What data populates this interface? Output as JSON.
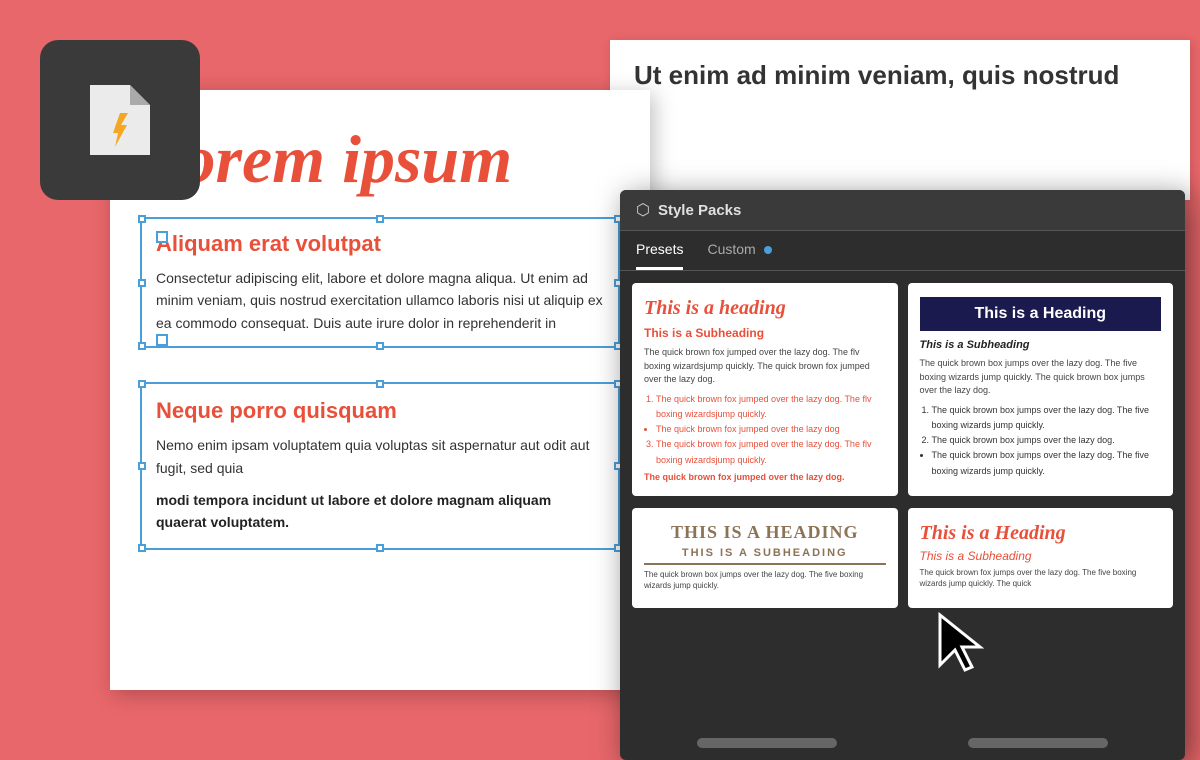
{
  "app": {
    "title": "Style Packs"
  },
  "background_doc": {
    "text": "Ut enim ad minim veniam, quis nostrud"
  },
  "document": {
    "title": "Lorem ipsum",
    "section1": {
      "heading": "Aliquam erat volutpat",
      "body": "Consectetur adipiscing elit, labore et dolore magna aliqua. Ut enim ad minim veniam, quis nostrud exercitation ullamco laboris nisi ut aliquip ex ea commodo consequat. Duis aute irure dolor in reprehenderit in"
    },
    "section2": {
      "heading": "Neque porro quisquam",
      "body": "Nemo enim ipsam voluptatem quia voluptas sit aspernatur aut odit aut fugit, sed quia",
      "bold": "modi tempora incidunt ut labore et dolore magnam aliquam quaerat voluptatem."
    }
  },
  "style_packs_panel": {
    "header": "Style Packs",
    "tabs": [
      {
        "label": "Presets",
        "active": true
      },
      {
        "label": "Custom",
        "active": false,
        "has_dot": true
      }
    ],
    "cards": [
      {
        "id": "card1",
        "heading": "This is a heading",
        "subheading": "This is a Subheading",
        "body": "The quick brown fox jumped over the lazy dog. The flv boxing wizardsjump quickly. The quick brown fox jumped over the lazy dog.",
        "list": [
          "The quick brown fox jumped over the lazy dog. The flv boxing wizardsjump quickly.",
          "The quick brown fox jumped over the lazy dog",
          "The quick brown fox jumped over the lazy dog. The flv boxing wizardsjump quickly."
        ],
        "bold": "The quick brown fox jumped over the lazy dog."
      },
      {
        "id": "card2",
        "heading": "This is a Heading",
        "subheading": "This is a Subheading",
        "body": "The quick brown box jumps over the lazy dog. The five boxing wizards jump quickly. The quick brown box jumps over the lazy dog.",
        "list": [
          "The quick brown box jumps over the lazy dog. The five boxing wizards jump quickly.",
          "The quick brown box jumps over the lazy dog.",
          "The quick brown box jumps over the lazy dog. The five boxing wizards jump quickly."
        ]
      }
    ],
    "bottom_cards": [
      {
        "id": "card3",
        "heading": "THIS IS A HEADING",
        "subheading": "THIS IS A SUBHEADING",
        "body": "The quick brown box jumps over the lazy dog. The five boxing wizards jump quickly."
      },
      {
        "id": "card4",
        "heading": "This is a Heading",
        "subheading": "This is a Subheading",
        "body": "The quick brown fox jumps over the lazy dog. The five boxing wizards jump quickly. The quick"
      }
    ]
  }
}
